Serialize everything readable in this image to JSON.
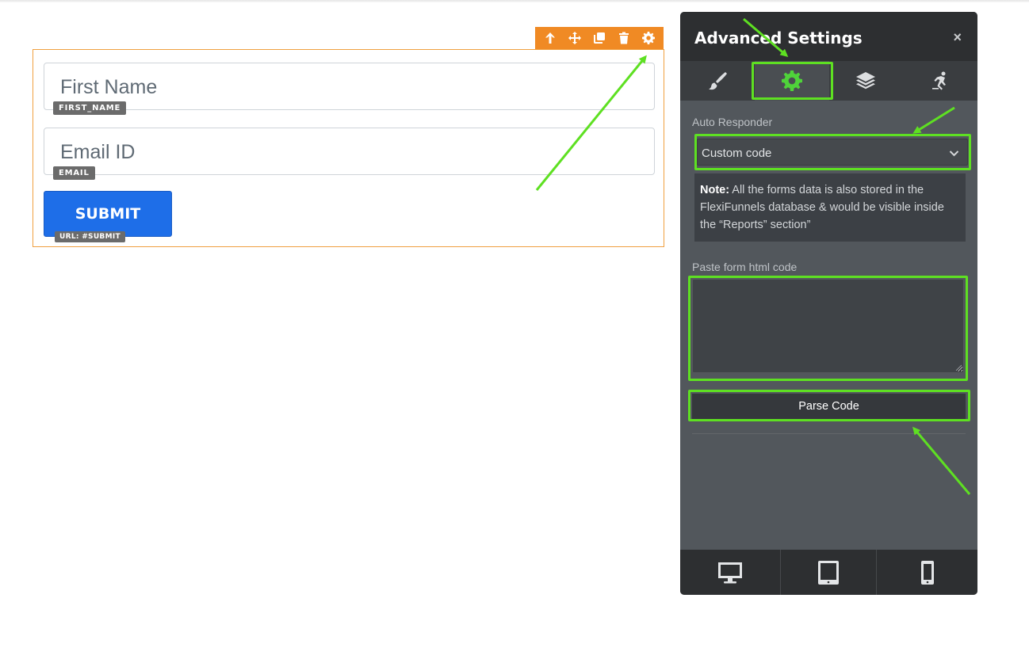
{
  "form": {
    "fields": [
      {
        "placeholder": "First Name",
        "tag": "FIRST_NAME"
      },
      {
        "placeholder": "Email ID",
        "tag": "EMAIL"
      }
    ],
    "submit": {
      "label": "SUBMIT",
      "tag": "URL: #SUBMIT"
    }
  },
  "toolbar_icons": [
    "arrow-up-icon",
    "move-icon",
    "duplicate-icon",
    "trash-icon",
    "gear-icon"
  ],
  "panel": {
    "title": "Advanced Settings",
    "close": "×",
    "tabs": [
      "brush-icon",
      "gear-icon",
      "layers-icon",
      "animation-icon"
    ],
    "active_tab": "gear-icon",
    "auto_responder_label": "Auto Responder",
    "auto_responder_value": "Custom code",
    "note_bold": "Note:",
    "note_text": " All the forms data is also stored in the FlexiFunnels database & would be visible inside the “Reports” section”",
    "paste_label": "Paste form html code",
    "paste_value": "",
    "parse_button": "Parse Code",
    "devices": [
      "desktop-icon",
      "tablet-icon",
      "mobile-icon"
    ]
  },
  "colors": {
    "toolbar_orange": "#f08a24",
    "submit_blue": "#1e6ee8",
    "highlight_green": "#5ee022",
    "panel_bg": "#52575c",
    "panel_header": "#2d2f31"
  }
}
